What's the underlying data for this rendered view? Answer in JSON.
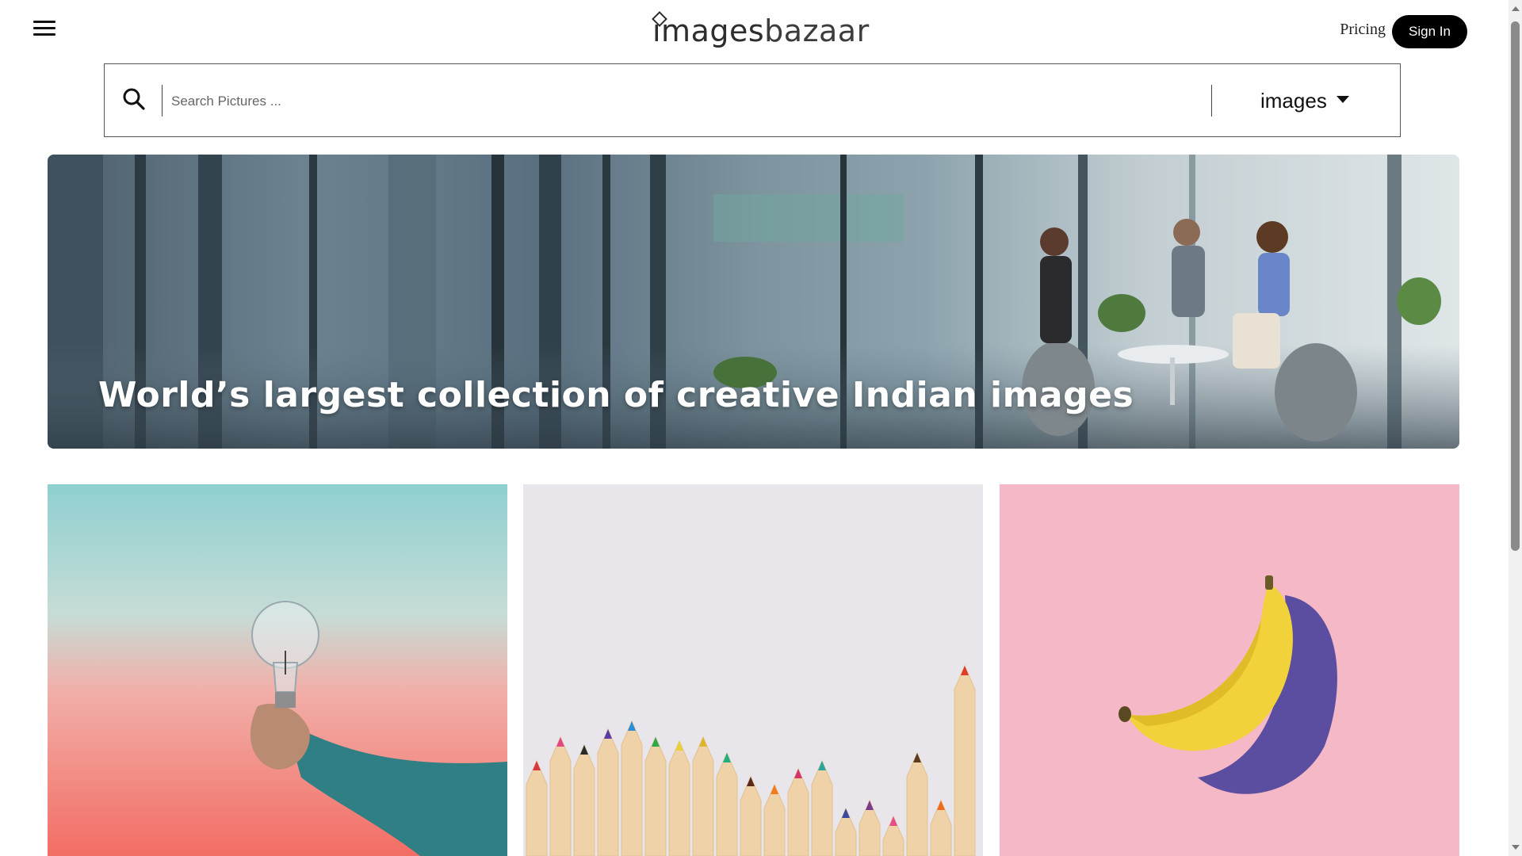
{
  "header": {
    "menu_icon": "hamburger-menu-icon",
    "logo": {
      "part_1": "images",
      "part_2": "bazaar"
    },
    "pricing_label": "Pricing",
    "signin_label": "Sign In"
  },
  "search": {
    "icon": "search-icon",
    "placeholder": "Search Pictures ...",
    "value": "",
    "type_selected": "images",
    "type_icon": "caret-down-icon"
  },
  "hero": {
    "title": "World’s largest collection of creative Indian images"
  },
  "gallery": {
    "tiles": [
      {
        "subject": "light bulb in hand"
      },
      {
        "subject": "colored pencils"
      },
      {
        "subject": "banana on pink"
      }
    ]
  },
  "colors": {
    "signin_bg": "#000000",
    "signin_text": "#ffffff",
    "tile_1_sky": "#9fd3d3",
    "tile_1_glow": "#f17a6e",
    "tile_2_bg": "#e8e6ea",
    "tile_3_bg": "#f5b8c6",
    "banana": "#f2d23a"
  }
}
